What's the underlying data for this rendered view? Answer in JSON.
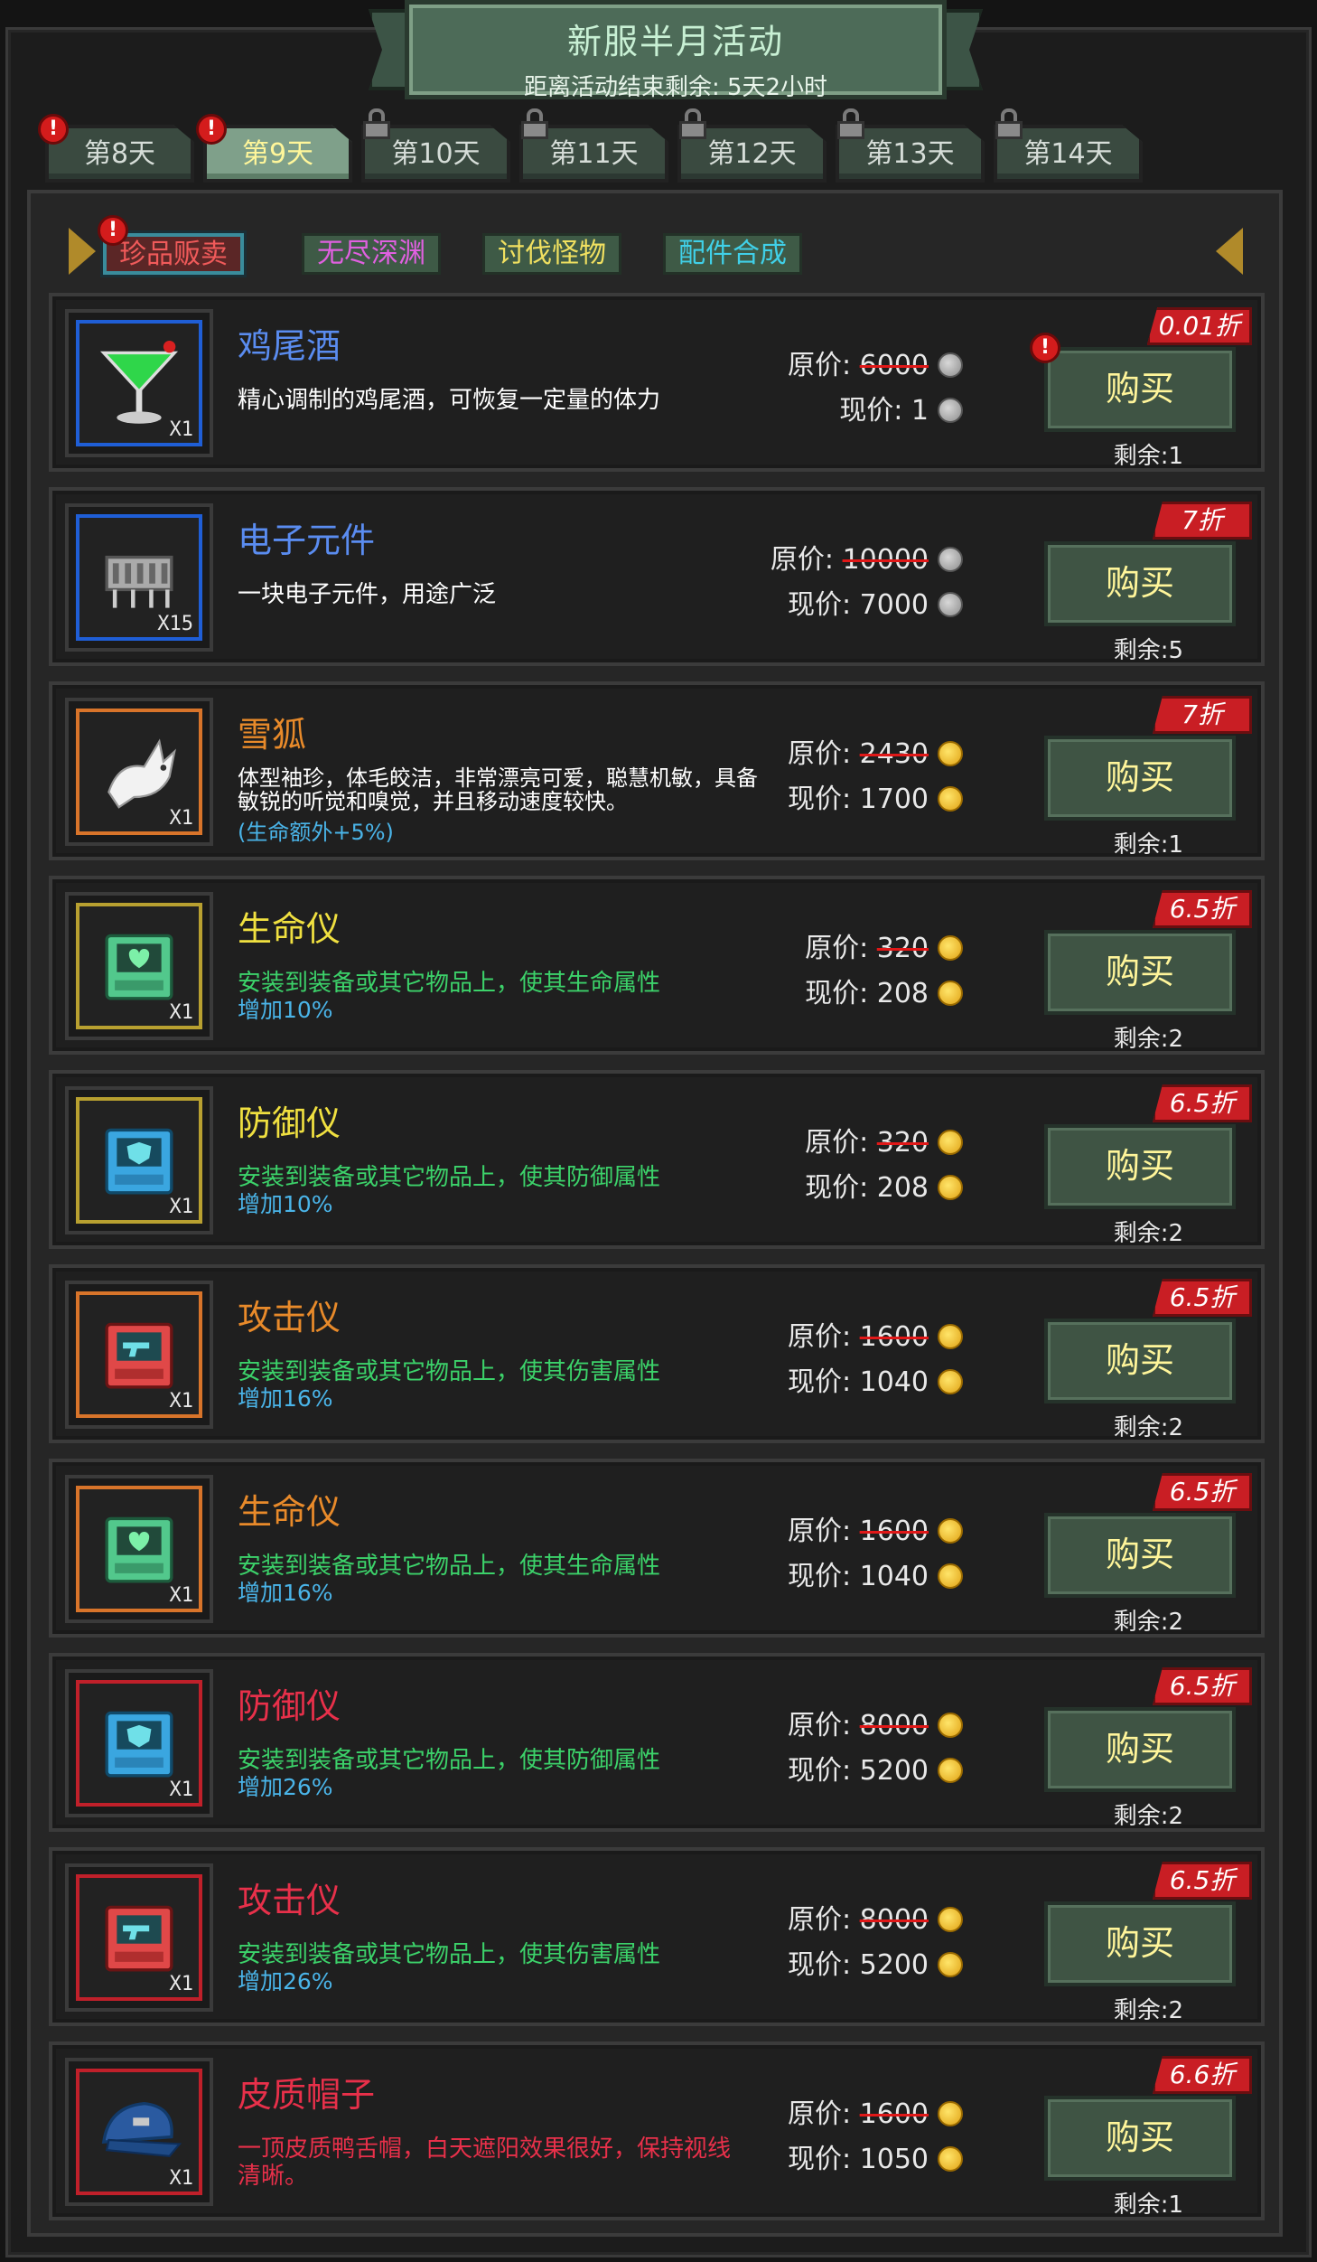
{
  "banner": {
    "title": "新服半月活动",
    "countdown": "距离活动结束剩余: 5天2小时"
  },
  "day_tabs": [
    {
      "label": "第8天",
      "active": false,
      "locked": false,
      "badge": "!"
    },
    {
      "label": "第9天",
      "active": true,
      "locked": false,
      "badge": "!"
    },
    {
      "label": "第10天",
      "active": false,
      "locked": true
    },
    {
      "label": "第11天",
      "active": false,
      "locked": true
    },
    {
      "label": "第12天",
      "active": false,
      "locked": true
    },
    {
      "label": "第13天",
      "active": false,
      "locked": true
    },
    {
      "label": "第14天",
      "active": false,
      "locked": true
    }
  ],
  "sub_tabs": [
    {
      "label": "珍品贩卖",
      "active": true,
      "badge": "!",
      "color": "#f05a5a"
    },
    {
      "label": "无尽深渊",
      "color": "#e060e0"
    },
    {
      "label": "讨伐怪物",
      "color": "#f0e060"
    },
    {
      "label": "配件合成",
      "color": "#40d0e8"
    }
  ],
  "labels": {
    "orig": "原价: ",
    "now": "现价: ",
    "buy": "购买",
    "remain_prefix": "剩余:"
  },
  "items": [
    {
      "name": "鸡尾酒",
      "name_color": "#5a8cf0",
      "rarity": "#1f5ed6",
      "icon": "cocktail-icon",
      "qty": "X1",
      "desc": "精心调制的鸡尾酒，可恢复一定量的体力",
      "desc_color": "#ffffff",
      "extra": "",
      "extra_color": "",
      "orig": "6000",
      "now": "1",
      "currency": "silver",
      "discount": "0.01折",
      "remain": "1",
      "badge": "!"
    },
    {
      "name": "电子元件",
      "name_color": "#5a8cf0",
      "rarity": "#1f5ed6",
      "icon": "chip-icon",
      "qty": "X15",
      "desc": "一块电子元件，用途广泛",
      "desc_color": "#ffffff",
      "extra": "",
      "extra_color": "",
      "orig": "10000",
      "now": "7000",
      "currency": "silver",
      "discount": "7折",
      "remain": "5"
    },
    {
      "name": "雪狐",
      "name_color": "#e88a2a",
      "rarity": "#d8742a",
      "icon": "snow-fox-icon",
      "qty": "X1",
      "desc": "体型袖珍，体毛皎洁，非常漂亮可爱，聪慧机敏，具备敏锐的听觉和嗅觉，并且移动速度较快。",
      "desc_color": "#ffffff",
      "extra": "(生命额外+5%)",
      "extra_color": "#4ab4e8",
      "orig": "2430",
      "now": "1700",
      "currency": "gold",
      "discount": "7折",
      "remain": "1"
    },
    {
      "name": "生命仪",
      "name_color": "#f0e040",
      "rarity": "#b8a030",
      "icon": "life-device-icon",
      "qty": "X1",
      "desc": "安装到装备或其它物品上，使其生命属性",
      "desc_color": "#3cd26a",
      "extra": "增加10%",
      "extra_color": "#4ab4e8",
      "orig": "320",
      "now": "208",
      "currency": "gold",
      "discount": "6.5折",
      "remain": "2"
    },
    {
      "name": "防御仪",
      "name_color": "#f0e040",
      "rarity": "#b8a030",
      "icon": "defense-device-icon",
      "qty": "X1",
      "desc": "安装到装备或其它物品上，使其防御属性",
      "desc_color": "#3cd26a",
      "extra": "增加10%",
      "extra_color": "#4ab4e8",
      "orig": "320",
      "now": "208",
      "currency": "gold",
      "discount": "6.5折",
      "remain": "2"
    },
    {
      "name": "攻击仪",
      "name_color": "#e88a2a",
      "rarity": "#d8742a",
      "icon": "attack-device-icon",
      "qty": "X1",
      "desc": "安装到装备或其它物品上，使其伤害属性",
      "desc_color": "#3cd26a",
      "extra": "增加16%",
      "extra_color": "#4ab4e8",
      "orig": "1600",
      "now": "1040",
      "currency": "gold",
      "discount": "6.5折",
      "remain": "2"
    },
    {
      "name": "生命仪",
      "name_color": "#e88a2a",
      "rarity": "#d8742a",
      "icon": "life-device-icon",
      "qty": "X1",
      "desc": "安装到装备或其它物品上，使其生命属性",
      "desc_color": "#3cd26a",
      "extra": "增加16%",
      "extra_color": "#4ab4e8",
      "orig": "1600",
      "now": "1040",
      "currency": "gold",
      "discount": "6.5折",
      "remain": "2"
    },
    {
      "name": "防御仪",
      "name_color": "#e8304a",
      "rarity": "#c0202a",
      "icon": "defense-device-icon",
      "qty": "X1",
      "desc": "安装到装备或其它物品上，使其防御属性",
      "desc_color": "#3cd26a",
      "extra": "增加26%",
      "extra_color": "#4ab4e8",
      "orig": "8000",
      "now": "5200",
      "currency": "gold",
      "discount": "6.5折",
      "remain": "2"
    },
    {
      "name": "攻击仪",
      "name_color": "#e8304a",
      "rarity": "#c0202a",
      "icon": "attack-device-icon",
      "qty": "X1",
      "desc": "安装到装备或其它物品上，使其伤害属性",
      "desc_color": "#3cd26a",
      "extra": "增加26%",
      "extra_color": "#4ab4e8",
      "orig": "8000",
      "now": "5200",
      "currency": "gold",
      "discount": "6.5折",
      "remain": "2"
    },
    {
      "name": "皮质帽子",
      "name_color": "#e8304a",
      "rarity": "#c0202a",
      "icon": "leather-cap-icon",
      "qty": "X1",
      "desc": "一顶皮质鸭舌帽，白天遮阳效果很好，保持视线清晰。",
      "desc_color": "#e8304a",
      "extra": "",
      "extra_color": "",
      "orig": "1600",
      "now": "1050",
      "currency": "gold",
      "discount": "6.6折",
      "remain": "1"
    }
  ]
}
